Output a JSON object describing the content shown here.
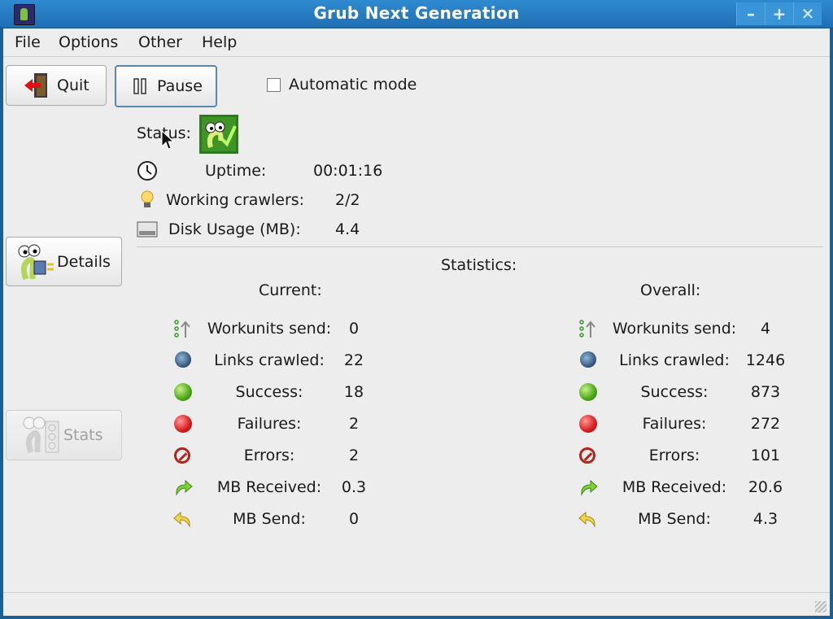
{
  "window": {
    "title": "Grub Next Generation",
    "controls": [
      "–",
      "+",
      "✕"
    ]
  },
  "menu": [
    "File",
    "Options",
    "Other",
    "Help"
  ],
  "buttons": {
    "quit": "Quit",
    "pause": "Pause",
    "details": "Details",
    "stats": "Stats"
  },
  "automatic_mode": {
    "label": "Automatic mode",
    "checked": false
  },
  "status": {
    "label": "Status:",
    "uptime_label": "Uptime:",
    "uptime_value": "00:01:16",
    "crawlers_label": "Working crawlers:",
    "crawlers_value": "2/2",
    "disk_label": "Disk Usage (MB):",
    "disk_value": "4.4"
  },
  "statistics": {
    "title": "Statistics:",
    "current_title": "Current:",
    "overall_title": "Overall:",
    "rows": [
      {
        "label": "Workunits send:",
        "icon": "upload-icon",
        "current": "0",
        "overall": "4"
      },
      {
        "label": "Links crawled:",
        "icon": "globe-icon",
        "current": "22",
        "overall": "1246"
      },
      {
        "label": "Success:",
        "icon": "green-dot-icon",
        "current": "18",
        "overall": "873"
      },
      {
        "label": "Failures:",
        "icon": "red-dot-icon",
        "current": "2",
        "overall": "272"
      },
      {
        "label": "Errors:",
        "icon": "no-entry-icon",
        "current": "2",
        "overall": "101"
      },
      {
        "label": "MB Received:",
        "icon": "arrow-redo-icon",
        "current": "0.3",
        "overall": "20.6"
      },
      {
        "label": "MB Send:",
        "icon": "arrow-undo-icon",
        "current": "0",
        "overall": "4.3"
      }
    ]
  }
}
